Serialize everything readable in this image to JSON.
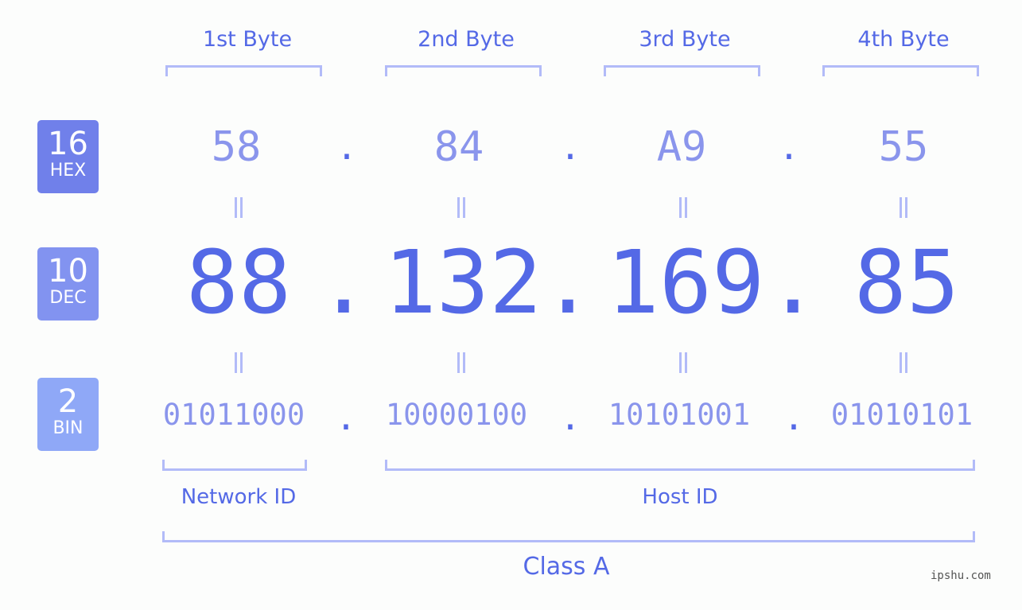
{
  "bytes": [
    {
      "label": "1st Byte",
      "hex": "58",
      "dec": "88",
      "bin": "01011000"
    },
    {
      "label": "2nd Byte",
      "hex": "84",
      "dec": "132",
      "bin": "10000100"
    },
    {
      "label": "3rd Byte",
      "hex": "A9",
      "dec": "169",
      "bin": "10101001"
    },
    {
      "label": "4th Byte",
      "hex": "55",
      "dec": "85",
      "bin": "01010101"
    }
  ],
  "separator": ".",
  "badges": {
    "hex": {
      "num": "16",
      "label": "HEX",
      "color": "#7080ea"
    },
    "dec": {
      "num": "10",
      "label": "DEC",
      "color": "#8293f0"
    },
    "bin": {
      "num": "2",
      "label": "BIN",
      "color": "#8fa8f7"
    }
  },
  "segments": {
    "network": "Network ID",
    "host": "Host ID",
    "class": "Class A"
  },
  "watermark": "ipshu.com",
  "colors": {
    "accent": "#5469e6",
    "light": "#8a95ec",
    "bracket": "#b2bbf8"
  }
}
